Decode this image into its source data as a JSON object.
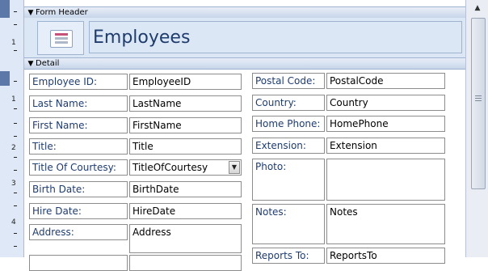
{
  "sections": {
    "form_header": "Form Header",
    "detail": "Detail"
  },
  "header": {
    "title": "Employees",
    "icon": "form-icon"
  },
  "ruler": {
    "labels": [
      "1",
      "1",
      "2",
      "3",
      "4"
    ]
  },
  "fields_left": [
    {
      "label": "Employee ID:",
      "value": "EmployeeID"
    },
    {
      "label": "Last Name:",
      "value": "LastName"
    },
    {
      "label": "First Name:",
      "value": "FirstName"
    },
    {
      "label": "Title:",
      "value": "Title"
    },
    {
      "label": "Title Of Courtesy:",
      "value": "TitleOfCourtesy"
    },
    {
      "label": "Birth Date:",
      "value": "BirthDate"
    },
    {
      "label": "Hire Date:",
      "value": "HireDate"
    },
    {
      "label": "Address:",
      "value": "Address"
    }
  ],
  "fields_right": [
    {
      "label": "Postal Code:",
      "value": "PostalCode"
    },
    {
      "label": "Country:",
      "value": "Country"
    },
    {
      "label": "Home Phone:",
      "value": "HomePhone"
    },
    {
      "label": "Extension:",
      "value": "Extension"
    },
    {
      "label": "Photo:",
      "value": ""
    },
    {
      "label": "Notes:",
      "value": "Notes"
    },
    {
      "label": "Reports To:",
      "value": "ReportsTo"
    }
  ]
}
